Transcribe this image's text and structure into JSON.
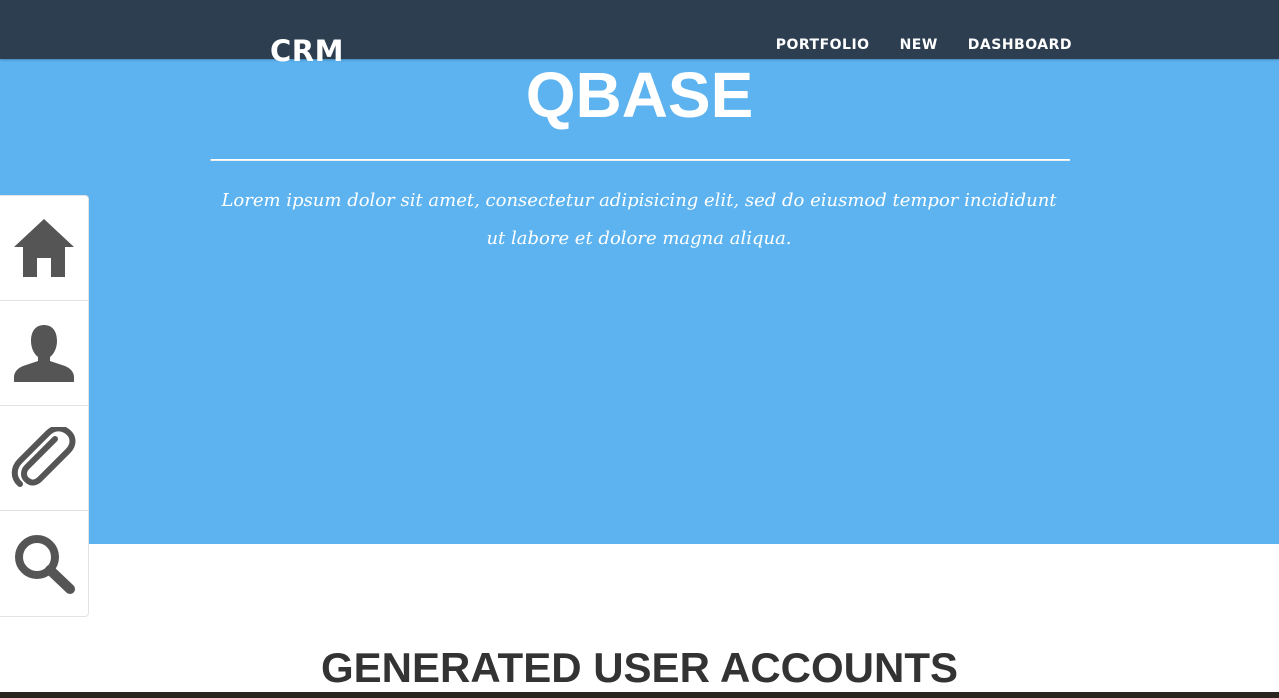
{
  "navbar": {
    "brand": "CRM",
    "links": [
      "PORTFOLIO",
      "NEW",
      "DASHBOARD"
    ],
    "background": "#2c3e50"
  },
  "hero": {
    "title": "QBASE",
    "text": "Lorem ipsum dolor sit amet, consectetur adipisicing elit, sed do eiusmod tempor incididunt ut labore et dolore magna aliqua.",
    "background": "#5cb3f0"
  },
  "side_menu": {
    "icons": [
      "home-icon",
      "user-icon",
      "paperclip-icon",
      "search-icon"
    ],
    "icon_color": "#555555"
  },
  "section": {
    "heading": "GENERATED USER ACCOUNTS"
  }
}
